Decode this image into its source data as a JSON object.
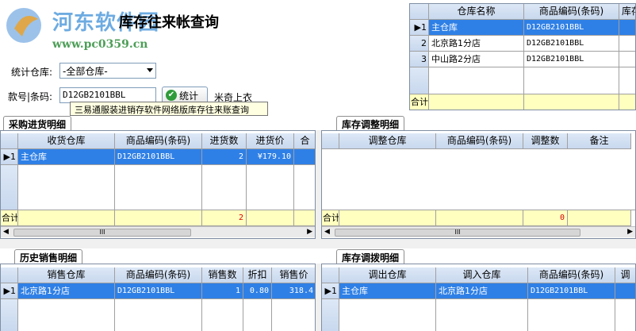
{
  "window": {
    "title": "库存往来帐查询"
  },
  "watermark": {
    "name": "河东软件园",
    "url": "www.pc0359.cn"
  },
  "filters": {
    "warehouse_label": "统计仓库:",
    "warehouse_value": "-全部仓库-",
    "code_label": "款号|条码:",
    "code_value": "D12GB2101BBL",
    "stat_button": "统计",
    "product_name": "米奇上衣",
    "tooltip": "三易通服装进销存软件网络版库存往来账查询"
  },
  "warehouse_grid": {
    "columns": [
      "仓库名称",
      "商品编码(条码)",
      "库存"
    ],
    "rows": [
      {
        "num": "1",
        "name": "主仓库",
        "code": "D12GB2101BBL",
        "selected": true
      },
      {
        "num": "2",
        "name": "北京路1分店",
        "code": "D12GB2101BBL",
        "selected": false
      },
      {
        "num": "3",
        "name": "中山路2分店",
        "code": "D12GB2101BBL",
        "selected": false
      }
    ],
    "total_label": "合计"
  },
  "purchase": {
    "tab": "采购进货明细",
    "columns": [
      "收货仓库",
      "商品编码(条码)",
      "进货数",
      "进货价",
      "合"
    ],
    "rows": [
      {
        "num": "1",
        "warehouse": "主仓库",
        "code": "D12GB2101BBL",
        "qty": "2",
        "price": "¥179.10"
      }
    ],
    "total_label": "合计",
    "total_qty": "2"
  },
  "adjust": {
    "tab": "库存调整明细",
    "columns": [
      "调整仓库",
      "商品编码(条码)",
      "调整数",
      "备注"
    ],
    "total_label": "合计",
    "total_qty": "0"
  },
  "sales": {
    "tab": "历史销售明细",
    "columns": [
      "销售仓库",
      "商品编码(条码)",
      "销售数",
      "折扣",
      "销售价"
    ],
    "rows": [
      {
        "num": "1",
        "warehouse": "北京路1分店",
        "code": "D12GB2101BBL",
        "qty": "1",
        "discount": "0.80",
        "price": "318.4"
      }
    ]
  },
  "transfer": {
    "tab": "库存调拨明细",
    "columns": [
      "调出仓库",
      "调入仓库",
      "商品编码(条码)",
      "调"
    ],
    "rows": [
      {
        "num": "1",
        "out": "主仓库",
        "in": "北京路1分店",
        "code": "D12GB2101BBL"
      }
    ]
  },
  "scroll": {
    "thumb": "III"
  }
}
